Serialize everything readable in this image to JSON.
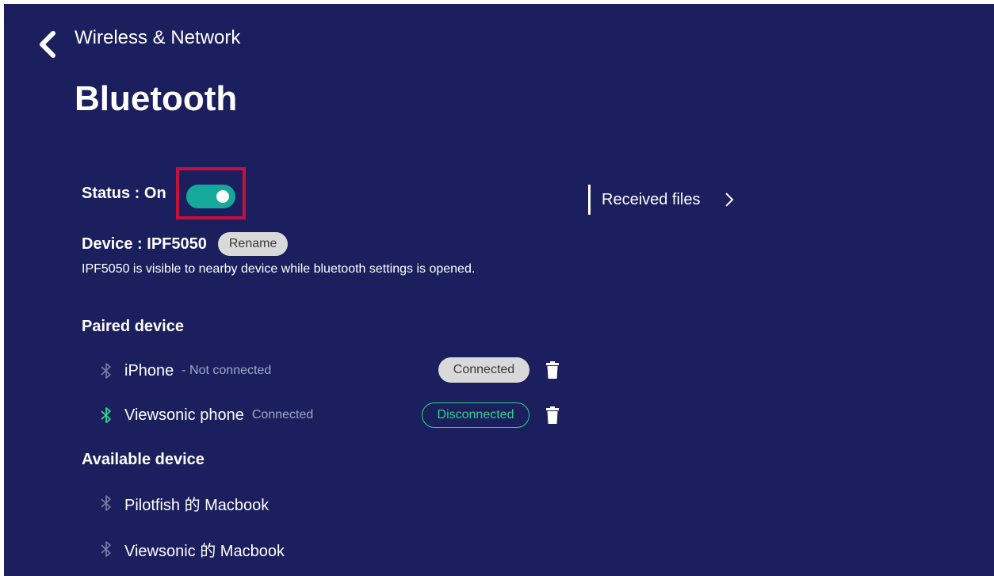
{
  "header": {
    "breadcrumb": "Wireless & Network",
    "title": "Bluetooth"
  },
  "status": {
    "label": "Status : On",
    "toggle_on": true
  },
  "device": {
    "label": "Device : IPF5050",
    "rename_label": "Rename",
    "visibility_note": "IPF5050 is visible to nearby device while bluetooth settings is opened."
  },
  "received_files": {
    "label": "Received files"
  },
  "paired": {
    "heading": "Paired device",
    "items": [
      {
        "name": "iPhone",
        "status": "- Not connected",
        "action": "Connected",
        "bt_active": false
      },
      {
        "name": "Viewsonic phone",
        "status": "Connected",
        "action": "Disconnected",
        "bt_active": true
      }
    ]
  },
  "available": {
    "heading": "Available device",
    "items": [
      {
        "name": "Pilotfish 的 Macbook"
      },
      {
        "name": "Viewsonic 的 Macbook"
      }
    ]
  },
  "colors": {
    "background": "#1b1f5e",
    "accent_toggle": "#16a89a",
    "connected_green": "#2ed48a",
    "highlight_box": "#c3123c"
  },
  "icons": [
    "back-arrow-icon",
    "chevron-right-icon",
    "bluetooth-icon",
    "trash-icon"
  ]
}
